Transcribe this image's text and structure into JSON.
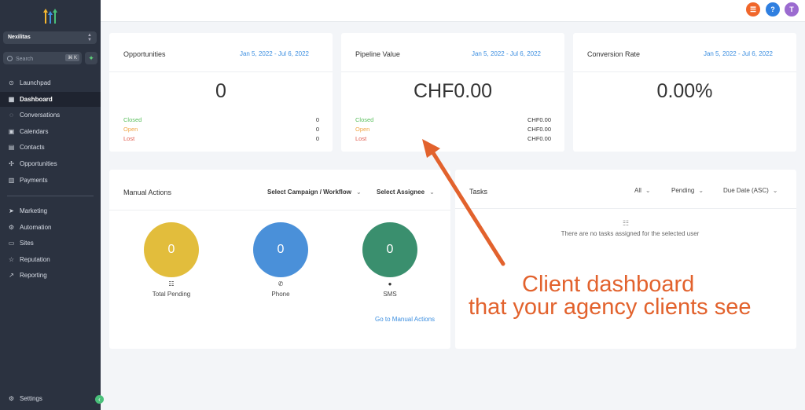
{
  "sidebar": {
    "account_name": "Nexilitas",
    "search_placeholder": "Search",
    "search_shortcut": "⌘ K",
    "nav": [
      {
        "label": "Launchpad",
        "icon": "launchpad-icon"
      },
      {
        "label": "Dashboard",
        "icon": "dashboard-icon",
        "active": true
      },
      {
        "label": "Conversations",
        "icon": "chat-icon"
      },
      {
        "label": "Calendars",
        "icon": "calendar-icon"
      },
      {
        "label": "Contacts",
        "icon": "contacts-icon"
      },
      {
        "label": "Opportunities",
        "icon": "opportunities-icon"
      },
      {
        "label": "Payments",
        "icon": "payments-icon"
      }
    ],
    "nav2": [
      {
        "label": "Marketing",
        "icon": "send-icon"
      },
      {
        "label": "Automation",
        "icon": "automation-icon"
      },
      {
        "label": "Sites",
        "icon": "sites-icon"
      },
      {
        "label": "Reputation",
        "icon": "star-icon"
      },
      {
        "label": "Reporting",
        "icon": "reporting-icon"
      }
    ],
    "settings": "Settings"
  },
  "topbar": {
    "avatar_initial": "T",
    "help": "?",
    "colors": {
      "orange": "#f0662a",
      "blue": "#2f7fe0",
      "purple": "#9b6bd0"
    }
  },
  "cards": {
    "opportunities": {
      "title": "Opportunities",
      "date": "Jan 5, 2022 - Jul 6, 2022",
      "value": "0",
      "stats": [
        {
          "label": "Closed",
          "value": "0"
        },
        {
          "label": "Open",
          "value": "0"
        },
        {
          "label": "Lost",
          "value": "0"
        }
      ]
    },
    "pipeline": {
      "title": "Pipeline Value",
      "date": "Jan 5, 2022 - Jul 6, 2022",
      "value": "CHF0.00",
      "stats": [
        {
          "label": "Closed",
          "value": "CHF0.00"
        },
        {
          "label": "Open",
          "value": "CHF0.00"
        },
        {
          "label": "Lost",
          "value": "CHF0.00"
        }
      ]
    },
    "conversion": {
      "title": "Conversion Rate",
      "date": "Jan 5, 2022 - Jul 6, 2022",
      "value": "0.00%"
    }
  },
  "manual_actions": {
    "title": "Manual Actions",
    "campaign_select": "Select Campaign / Workflow",
    "assignee_select": "Select Assignee",
    "circles": [
      {
        "value": "0",
        "label": "Total Pending",
        "color": "#e2bd3c"
      },
      {
        "value": "0",
        "label": "Phone",
        "color": "#4a90d9"
      },
      {
        "value": "0",
        "label": "SMS",
        "color": "#3a8f6e"
      }
    ],
    "link": "Go to Manual Actions"
  },
  "tasks": {
    "title": "Tasks",
    "filter_all": "All",
    "filter_status": "Pending",
    "filter_sort": "Due Date (ASC)",
    "empty_text": "There are no tasks assigned for the selected user"
  },
  "annotation": {
    "line1": "Client dashboard",
    "line2": "that your agency clients see",
    "color": "#e2622d"
  }
}
